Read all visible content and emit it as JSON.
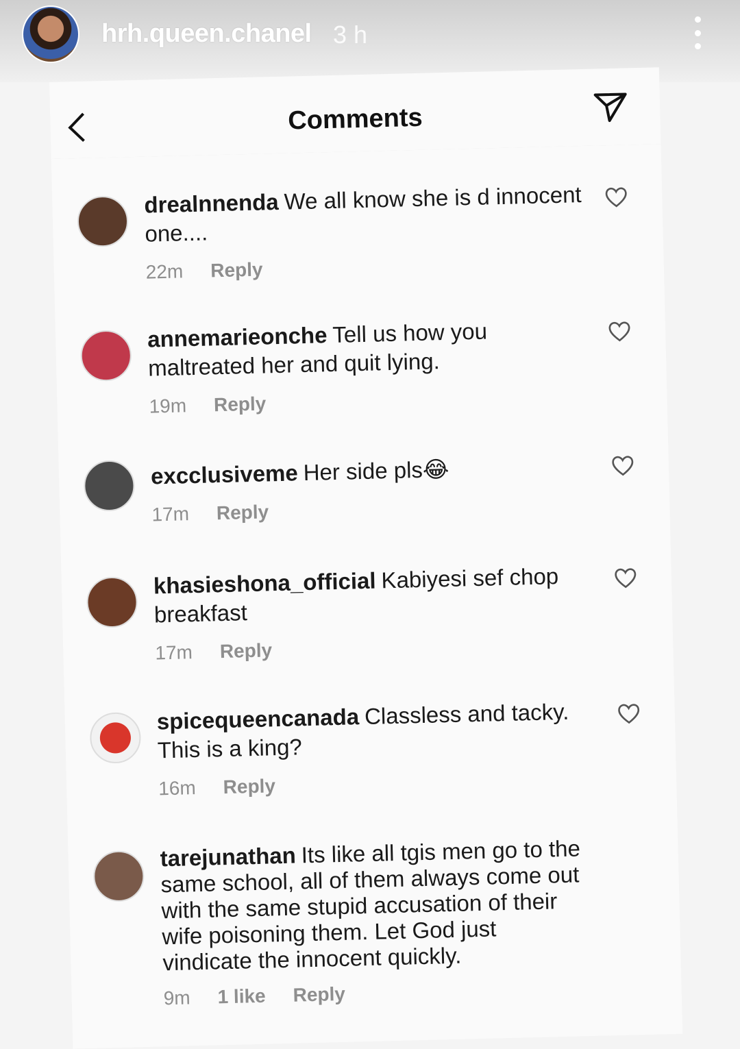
{
  "story": {
    "username": "hrh.queen.chanel",
    "time": "3 h"
  },
  "header": {
    "title": "Comments"
  },
  "comments": [
    {
      "username": "drealnnenda",
      "text": "We all know she is d innocent one....",
      "time": "22m",
      "reply_label": "Reply",
      "avatar_color": "#5a3a2a"
    },
    {
      "username": "annemarieonche",
      "text": "Tell us how you maltreated her and quit lying.",
      "time": "19m",
      "reply_label": "Reply",
      "avatar_color": "#c0394b"
    },
    {
      "username": "excclusiveme",
      "text": "Her side pls😂",
      "time": "17m",
      "reply_label": "Reply",
      "avatar_color": "#4a4a4a"
    },
    {
      "username": "khasieshona_official",
      "text": "Kabiyesi sef chop breakfast",
      "time": "17m",
      "reply_label": "Reply",
      "avatar_color": "#6b3b26"
    },
    {
      "username": "spicequeencanada",
      "text": "Classless and tacky. This is a king?",
      "time": "16m",
      "reply_label": "Reply",
      "avatar_color": "#d9362b"
    },
    {
      "username": "tarejunathan",
      "text": "Its like all tgis men go to the same school, all of them always come out with the same stupid accusation of their wife poisoning them. Let God just vindicate the innocent quickly.",
      "time": "9m",
      "likes": "1 like",
      "reply_label": "Reply",
      "avatar_color": "#7a5a4a"
    }
  ],
  "icons": {
    "back": "chevron-left-icon",
    "send": "paper-plane-icon",
    "like": "heart-outline-icon",
    "more": "vertical-dots-icon"
  }
}
